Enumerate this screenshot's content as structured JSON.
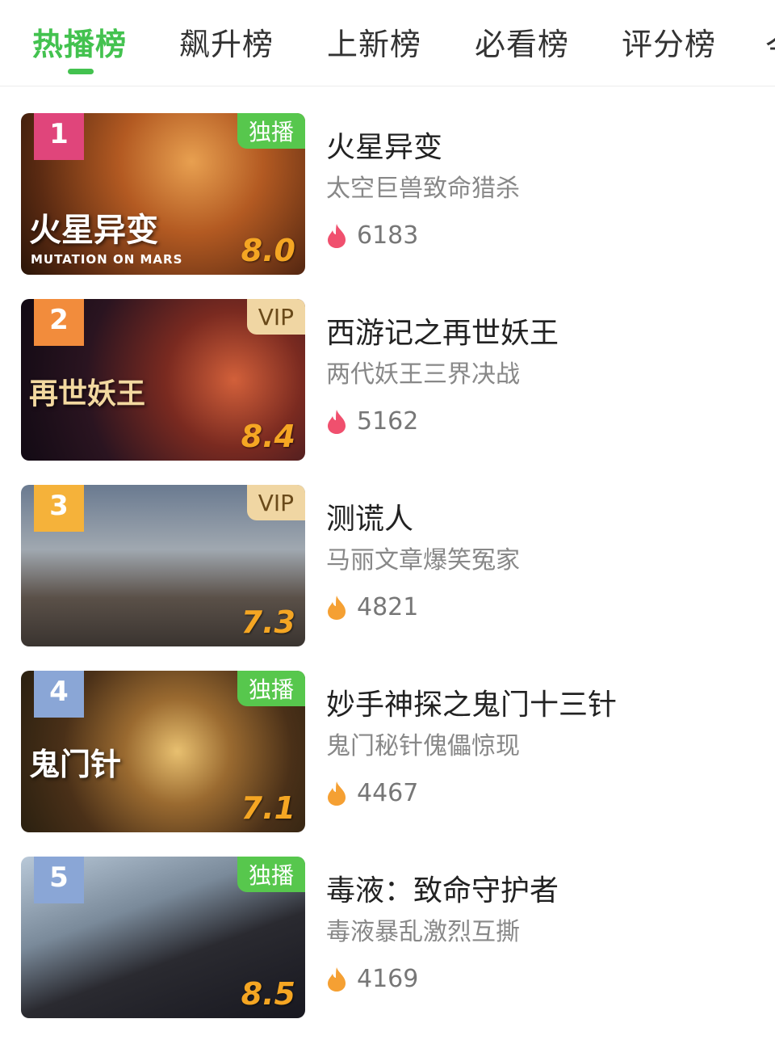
{
  "tabs": {
    "items": [
      "热播榜",
      "飙升榜",
      "上新榜",
      "必看榜",
      "评分榜"
    ],
    "partial": "今"
  },
  "items": [
    {
      "rank": "1",
      "title": "火星异变",
      "subtitle": "太空巨兽致命猎杀",
      "heat": "6183",
      "tag": "独播",
      "score": "8.0",
      "poster_title": "火星异变",
      "poster_sub": "MUTATION ON MARS"
    },
    {
      "rank": "2",
      "title": "西游记之再世妖王",
      "subtitle": "两代妖王三界决战",
      "heat": "5162",
      "tag": "VIP",
      "score": "8.4",
      "poster_title": "再世妖王",
      "poster_sub": ""
    },
    {
      "rank": "3",
      "title": "测谎人",
      "subtitle": "马丽文章爆笑冤家",
      "heat": "4821",
      "tag": "VIP",
      "score": "7.3",
      "poster_title": "",
      "poster_sub": ""
    },
    {
      "rank": "4",
      "title": "妙手神探之鬼门十三针",
      "subtitle": "鬼门秘针傀儡惊现",
      "heat": "4467",
      "tag": "独播",
      "score": "7.1",
      "poster_title": "鬼门针",
      "poster_sub": ""
    },
    {
      "rank": "5",
      "title": "毒液：致命守护者",
      "subtitle": "毒液暴乱激烈互撕",
      "heat": "4169",
      "tag": "独播",
      "score": "8.5",
      "poster_title": "",
      "poster_sub": ""
    }
  ],
  "colors": {
    "accent": "#43c24f",
    "exclusive_tag": "#57c74d",
    "vip_tag": "#f0d6a3",
    "rank1": "#e0457b",
    "rank2": "#f28c3c",
    "rank3": "#f5b23a",
    "rank_other": "#8aa6d6",
    "heat_red": "#f0506e",
    "heat_orange": "#f5a033",
    "score": "#f5a623"
  },
  "icons": {
    "heat": "flame-icon"
  }
}
